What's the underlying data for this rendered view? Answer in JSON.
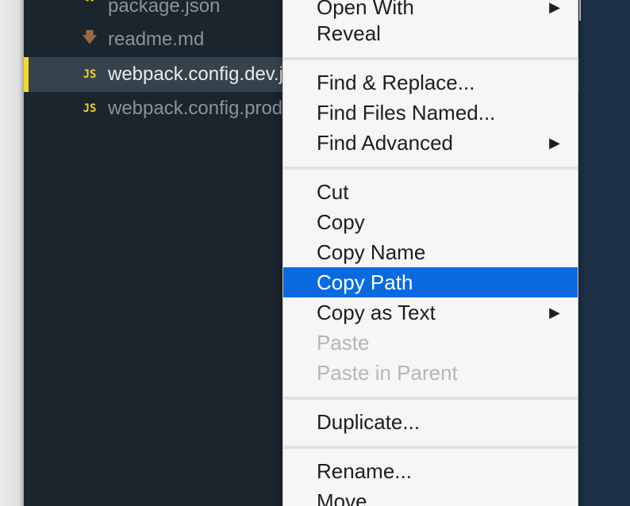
{
  "files": [
    {
      "name": "package.json",
      "icon": "json-file-icon",
      "glyph": "{}",
      "selected": false
    },
    {
      "name": "readme.md",
      "icon": "markdown-file-icon",
      "glyph": "🡇",
      "selected": false
    },
    {
      "name": "webpack.config.dev.js",
      "icon": "js-file-icon",
      "glyph": "JS",
      "selected": true
    },
    {
      "name": "webpack.config.prod.js",
      "icon": "js-file-icon",
      "glyph": "JS",
      "selected": false
    }
  ],
  "context_menu": {
    "items": [
      {
        "label": "Open With",
        "submenu": true,
        "disabled": false
      },
      {
        "label": "Reveal",
        "submenu": false,
        "disabled": false
      },
      {
        "separator": true
      },
      {
        "label": "Find & Replace...",
        "submenu": false,
        "disabled": false
      },
      {
        "label": "Find Files Named...",
        "submenu": false,
        "disabled": false
      },
      {
        "label": "Find Advanced",
        "submenu": true,
        "disabled": false
      },
      {
        "separator": true
      },
      {
        "label": "Cut",
        "submenu": false,
        "disabled": false
      },
      {
        "label": "Copy",
        "submenu": false,
        "disabled": false
      },
      {
        "label": "Copy Name",
        "submenu": false,
        "disabled": false
      },
      {
        "label": "Copy Path",
        "submenu": false,
        "disabled": false,
        "highlighted": true
      },
      {
        "label": "Copy as Text",
        "submenu": true,
        "disabled": false
      },
      {
        "label": "Paste",
        "submenu": false,
        "disabled": true
      },
      {
        "label": "Paste in Parent",
        "submenu": false,
        "disabled": true
      },
      {
        "separator": true
      },
      {
        "label": "Duplicate...",
        "submenu": false,
        "disabled": false
      },
      {
        "separator": true
      },
      {
        "label": "Rename...",
        "submenu": false,
        "disabled": false
      },
      {
        "label": "Move",
        "submenu": false,
        "disabled": false
      }
    ],
    "submenu_arrow": "▶"
  },
  "colors": {
    "sidebar_bg": "#1b252e",
    "selection_accent": "#f3d92a",
    "menu_highlight": "#0b6ae0"
  }
}
